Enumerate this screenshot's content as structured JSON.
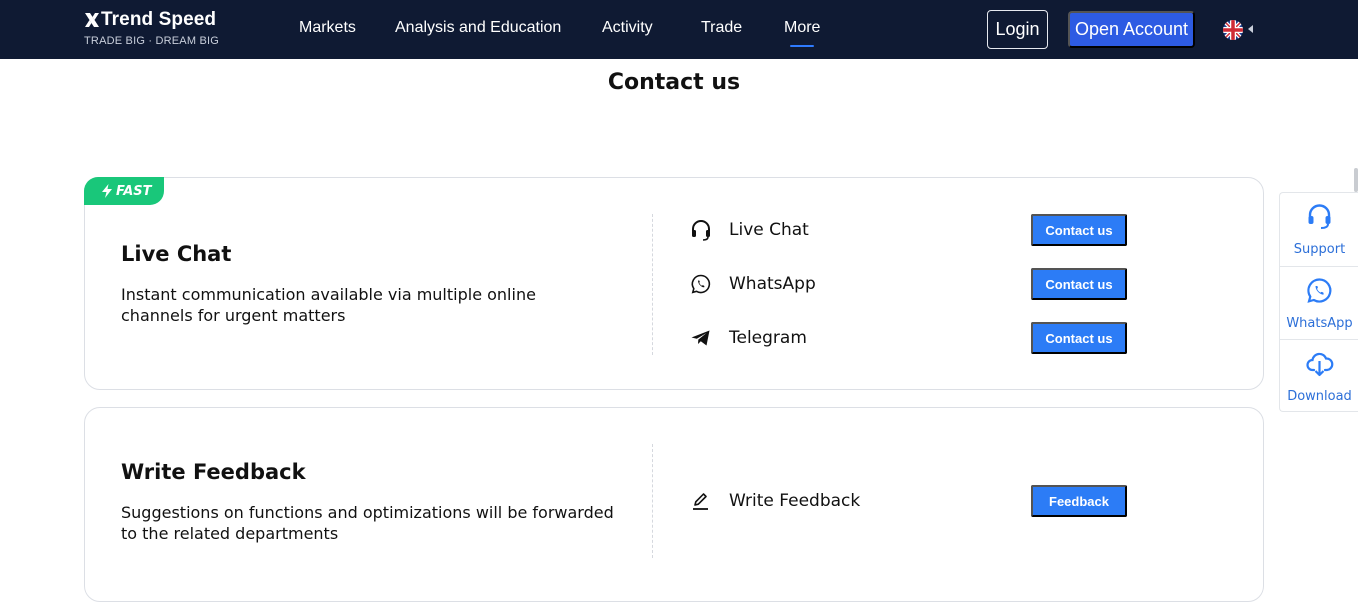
{
  "header": {
    "logo_text": "Trend Speed",
    "logo_tagline": "TRADE BIG · DREAM BIG",
    "nav": [
      {
        "label": "Markets"
      },
      {
        "label": "Analysis and Education"
      },
      {
        "label": "Activity"
      },
      {
        "label": "Trade"
      },
      {
        "label": "More",
        "active": true
      }
    ],
    "login_label": "Login",
    "open_account_label": "Open Account",
    "language_icon": "uk-flag-icon",
    "colors": {
      "background": "#0f1a33",
      "accent": "#2f7bff",
      "open_account": "#2d5be3"
    }
  },
  "page": {
    "title": "Contact us"
  },
  "cards": [
    {
      "badge": "FAST",
      "title": "Live Chat",
      "description": "Instant communication available via multiple online channels for urgent matters",
      "channels": [
        {
          "icon": "headset-icon",
          "label": "Live Chat",
          "button": "Contact us"
        },
        {
          "icon": "whatsapp-icon",
          "label": "WhatsApp",
          "button": "Contact us"
        },
        {
          "icon": "telegram-icon",
          "label": "Telegram",
          "button": "Contact us"
        }
      ]
    },
    {
      "title": "Write Feedback",
      "description": "Suggestions on functions and optimizations will be forwarded to the related departments",
      "channels": [
        {
          "icon": "pencil-icon",
          "label": "Write Feedback",
          "button": "Feedback"
        }
      ]
    }
  ],
  "sidebar": {
    "items": [
      {
        "icon": "headset-icon",
        "label": "Support"
      },
      {
        "icon": "whatsapp-icon",
        "label": "WhatsApp"
      },
      {
        "icon": "cloud-download-icon",
        "label": "Download"
      }
    ]
  },
  "colors": {
    "button": "#2c7cf6",
    "badge": "#19c77a",
    "side_label": "#2c6fd8"
  }
}
